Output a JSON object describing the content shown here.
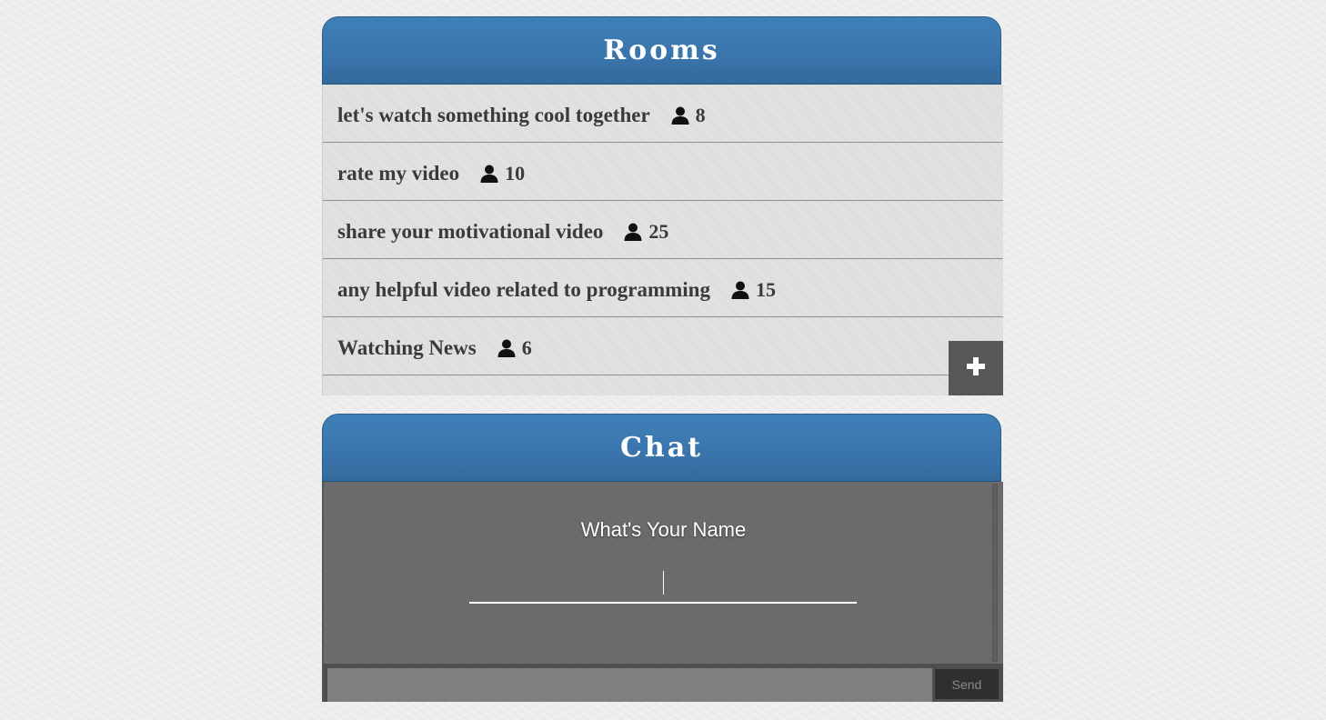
{
  "rooms": {
    "title": "Rooms",
    "items": [
      {
        "name": "let's watch something cool together",
        "count": "8"
      },
      {
        "name": "rate my video",
        "count": "10"
      },
      {
        "name": "share your motivational video",
        "count": "25"
      },
      {
        "name": "any helpful video related to programming",
        "count": "15"
      },
      {
        "name": "Watching News",
        "count": "6"
      }
    ],
    "add_icon": "plus-icon",
    "user_icon": "person-icon"
  },
  "chat": {
    "title": "Chat",
    "name_prompt": "What's Your Name",
    "name_value": "",
    "message_value": "",
    "send_label": "Send"
  },
  "colors": {
    "header_blue": "#3a76ad",
    "chat_body": "#6c6c6c",
    "send_button": "#2f2f2f",
    "add_button": "#575757"
  }
}
